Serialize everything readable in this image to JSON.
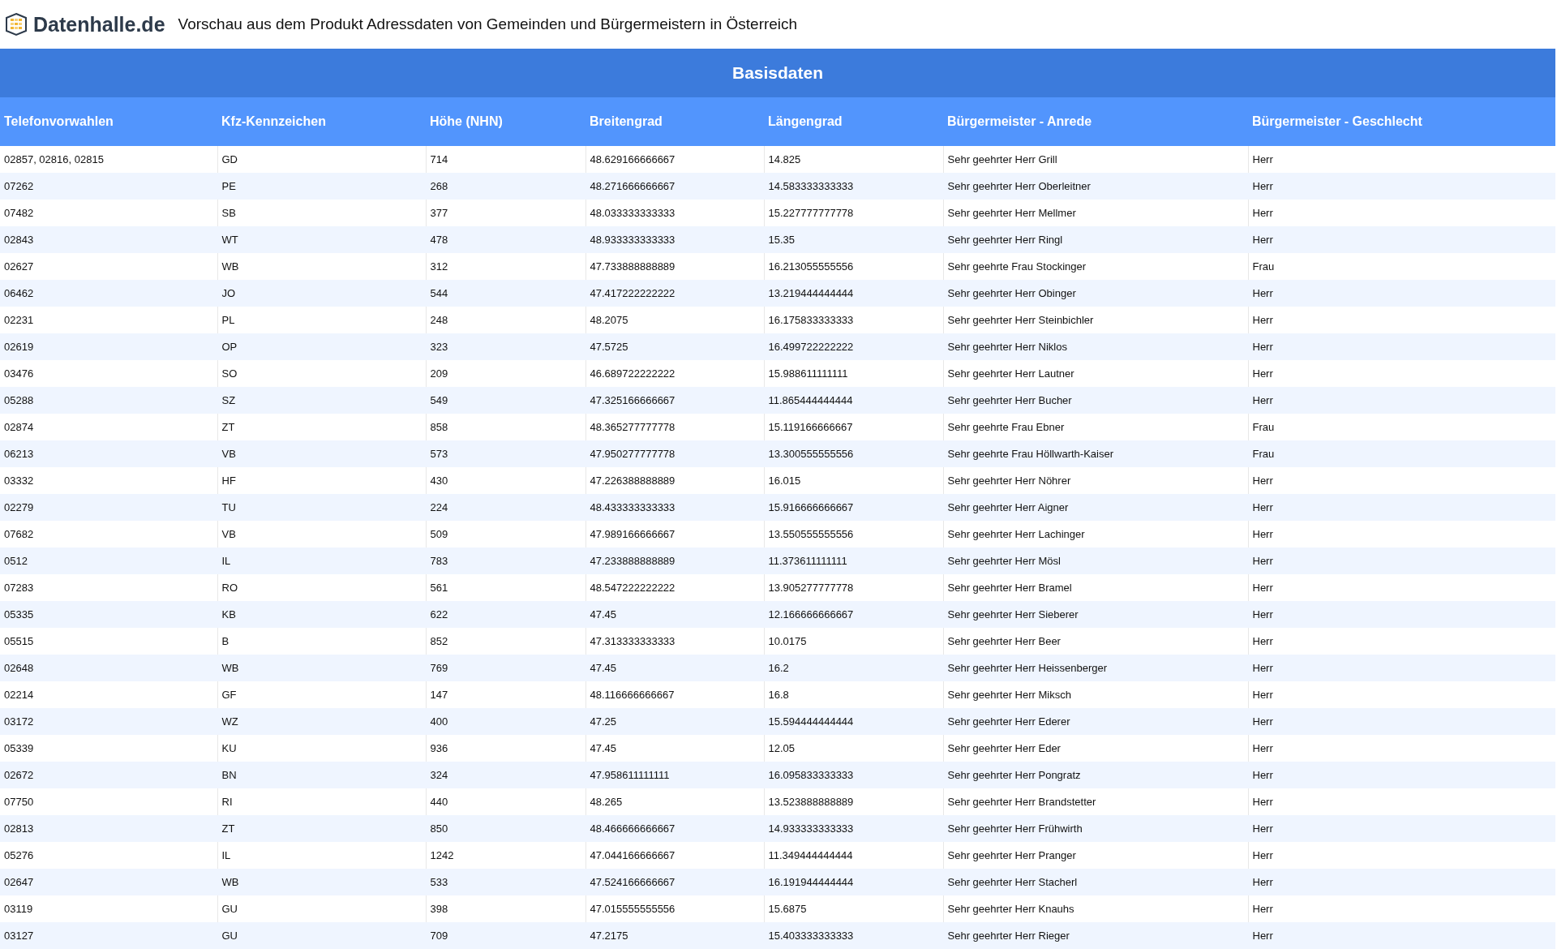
{
  "header": {
    "logo_text": "Datenhalle.de",
    "title": "Vorschau aus dem Produkt Adressdaten von Gemeinden und Bürgermeistern in Österreich"
  },
  "table": {
    "group_title": "Basisdaten",
    "columns": [
      "Telefonvorwahlen",
      "Kfz-Kennzeichen",
      "Höhe (NHN)",
      "Breitengrad",
      "Längengrad",
      "Bürgermeister - Anrede",
      "Bürgermeister - Geschlecht"
    ],
    "rows": [
      [
        "02857, 02816, 02815",
        "GD",
        "714",
        "48.629166666667",
        "14.825",
        "Sehr geehrter Herr Grill",
        "Herr"
      ],
      [
        "07262",
        "PE",
        "268",
        "48.271666666667",
        "14.583333333333",
        "Sehr geehrter Herr Oberleitner",
        "Herr"
      ],
      [
        "07482",
        "SB",
        "377",
        "48.033333333333",
        "15.227777777778",
        "Sehr geehrter Herr Mellmer",
        "Herr"
      ],
      [
        "02843",
        "WT",
        "478",
        "48.933333333333",
        "15.35",
        "Sehr geehrter Herr Ringl",
        "Herr"
      ],
      [
        "02627",
        "WB",
        "312",
        "47.733888888889",
        "16.213055555556",
        "Sehr geehrte Frau Stockinger",
        "Frau"
      ],
      [
        "06462",
        "JO",
        "544",
        "47.417222222222",
        "13.219444444444",
        "Sehr geehrter Herr Obinger",
        "Herr"
      ],
      [
        "02231",
        "PL",
        "248",
        "48.2075",
        "16.175833333333",
        "Sehr geehrter Herr Steinbichler",
        "Herr"
      ],
      [
        "02619",
        "OP",
        "323",
        "47.5725",
        "16.499722222222",
        "Sehr geehrter Herr Niklos",
        "Herr"
      ],
      [
        "03476",
        "SO",
        "209",
        "46.689722222222",
        "15.988611111111",
        "Sehr geehrter Herr Lautner",
        "Herr"
      ],
      [
        "05288",
        "SZ",
        "549",
        "47.325166666667",
        "11.865444444444",
        "Sehr geehrter Herr Bucher",
        "Herr"
      ],
      [
        "02874",
        "ZT",
        "858",
        "48.365277777778",
        "15.119166666667",
        "Sehr geehrte Frau Ebner",
        "Frau"
      ],
      [
        "06213",
        "VB",
        "573",
        "47.950277777778",
        "13.300555555556",
        "Sehr geehrte Frau Höllwarth-Kaiser",
        "Frau"
      ],
      [
        "03332",
        "HF",
        "430",
        "47.226388888889",
        "16.015",
        "Sehr geehrter Herr Nöhrer",
        "Herr"
      ],
      [
        "02279",
        "TU",
        "224",
        "48.433333333333",
        "15.916666666667",
        "Sehr geehrter Herr Aigner",
        "Herr"
      ],
      [
        "07682",
        "VB",
        "509",
        "47.989166666667",
        "13.550555555556",
        "Sehr geehrter Herr Lachinger",
        "Herr"
      ],
      [
        "0512",
        "IL",
        "783",
        "47.233888888889",
        "11.373611111111",
        "Sehr geehrter Herr Mösl",
        "Herr"
      ],
      [
        "07283",
        "RO",
        "561",
        "48.547222222222",
        "13.905277777778",
        "Sehr geehrter Herr Bramel",
        "Herr"
      ],
      [
        "05335",
        "KB",
        "622",
        "47.45",
        "12.166666666667",
        "Sehr geehrter Herr Sieberer",
        "Herr"
      ],
      [
        "05515",
        "B",
        "852",
        "47.313333333333",
        "10.0175",
        "Sehr geehrter Herr Beer",
        "Herr"
      ],
      [
        "02648",
        "WB",
        "769",
        "47.45",
        "16.2",
        "Sehr geehrter Herr Heissenberger",
        "Herr"
      ],
      [
        "02214",
        "GF",
        "147",
        "48.116666666667",
        "16.8",
        "Sehr geehrter Herr Miksch",
        "Herr"
      ],
      [
        "03172",
        "WZ",
        "400",
        "47.25",
        "15.594444444444",
        "Sehr geehrter Herr Ederer",
        "Herr"
      ],
      [
        "05339",
        "KU",
        "936",
        "47.45",
        "12.05",
        "Sehr geehrter Herr Eder",
        "Herr"
      ],
      [
        "02672",
        "BN",
        "324",
        "47.958611111111",
        "16.095833333333",
        "Sehr geehrter Herr Pongratz",
        "Herr"
      ],
      [
        "07750",
        "RI",
        "440",
        "48.265",
        "13.523888888889",
        "Sehr geehrter Herr Brandstetter",
        "Herr"
      ],
      [
        "02813",
        "ZT",
        "850",
        "48.466666666667",
        "14.933333333333",
        "Sehr geehrter Herr Frühwirth",
        "Herr"
      ],
      [
        "05276",
        "IL",
        "1242",
        "47.044166666667",
        "11.349444444444",
        "Sehr geehrter Herr Pranger",
        "Herr"
      ],
      [
        "02647",
        "WB",
        "533",
        "47.524166666667",
        "16.191944444444",
        "Sehr geehrter Herr Stacherl",
        "Herr"
      ],
      [
        "03119",
        "GU",
        "398",
        "47.015555555556",
        "15.6875",
        "Sehr geehrter Herr Knauhs",
        "Herr"
      ],
      [
        "03127",
        "GU",
        "709",
        "47.2175",
        "15.403333333333",
        "Sehr geehrter Herr Rieger",
        "Herr"
      ]
    ]
  }
}
